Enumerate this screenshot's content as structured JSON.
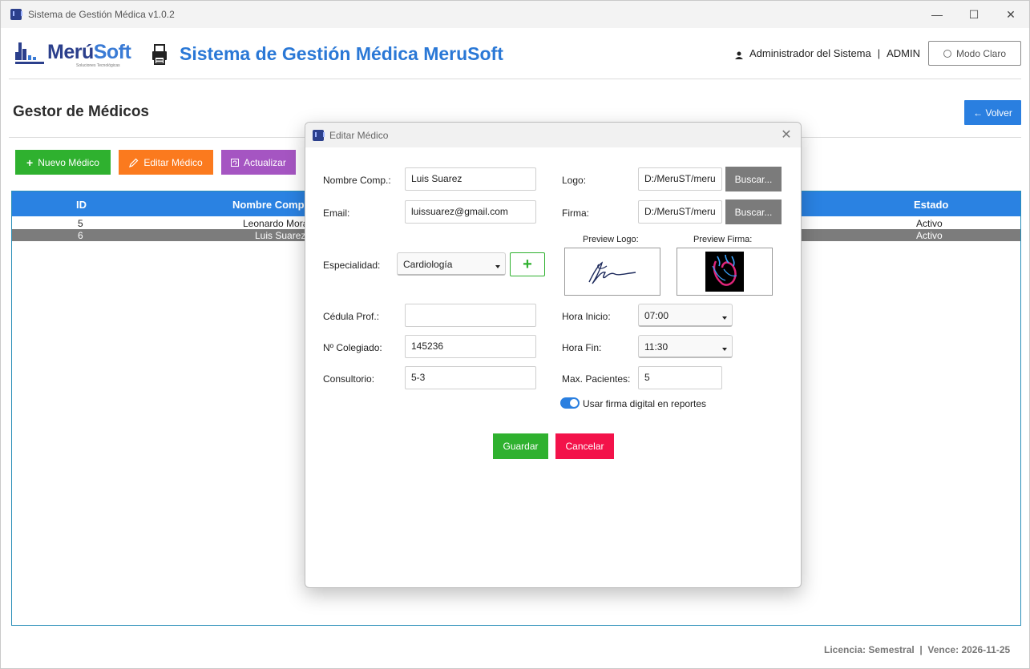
{
  "window": {
    "title": "Sistema de Gestión Médica v1.0.2",
    "controls": {
      "minimize": "—",
      "maximize": "☐",
      "close": "✕"
    }
  },
  "header": {
    "brand_name_a": "Merú",
    "brand_name_b": "Soft",
    "brand_sub": "Soluciones Tecnológicas",
    "title": "Sistema de Gestión Médica MeruSoft",
    "user": "Administrador del Sistema",
    "separator": "|",
    "role": "ADMIN",
    "mode_label": "Modo Claro"
  },
  "page": {
    "title": "Gestor de Médicos",
    "back_label": "← Volver"
  },
  "toolbar": {
    "new_label": "Nuevo Médico",
    "edit_label": "Editar Médico",
    "refresh_label": "Actualizar"
  },
  "grid": {
    "columns": {
      "id": "ID",
      "name": "Nombre Comp",
      "status": "Estado"
    },
    "rows": [
      {
        "id": "5",
        "name": "Leonardo Morá",
        "status": "Activo"
      },
      {
        "id": "6",
        "name": "Luis Suarez",
        "status": "Activo"
      }
    ]
  },
  "dialog": {
    "title": "Editar Médico",
    "close": "✕",
    "labels": {
      "name": "Nombre Comp.:",
      "email": "Email:",
      "specialty": "Especialidad:",
      "cedula": "Cédula Prof.:",
      "colegiado": "Nº Colegiado:",
      "consultorio": "Consultorio:",
      "logo": "Logo:",
      "firma": "Firma:",
      "preview_logo": "Preview Logo:",
      "preview_firma": "Preview Firma:",
      "hora_inicio": "Hora Inicio:",
      "hora_fin": "Hora Fin:",
      "max_pacientes": "Max. Pacientes:",
      "toggle": "Usar firma digital en reportes"
    },
    "values": {
      "name": "Luis Suarez",
      "email": "luissuarez@gmail.com",
      "specialty": "Cardiología",
      "cedula": "",
      "colegiado": "145236",
      "consultorio": "5-3",
      "logo_path": "D:/MeruST/meru",
      "firma_path": "D:/MeruST/meru",
      "hora_inicio": "07:00",
      "hora_fin": "11:30",
      "max_pacientes": "5"
    },
    "toggle_on": true,
    "buttons": {
      "buscar": "Buscar...",
      "add_specialty": "+",
      "save": "Guardar",
      "cancel": "Cancelar"
    }
  },
  "footer": {
    "license": "Licencia: Semestral  |  Vence: 2026-11-25"
  },
  "colors": {
    "accent_blue": "#2a7fe0",
    "green": "#2fb12f",
    "orange": "#fb7a1e",
    "purple": "#a555c2",
    "red": "#f3124a",
    "gray_button": "#7b7b7b"
  }
}
